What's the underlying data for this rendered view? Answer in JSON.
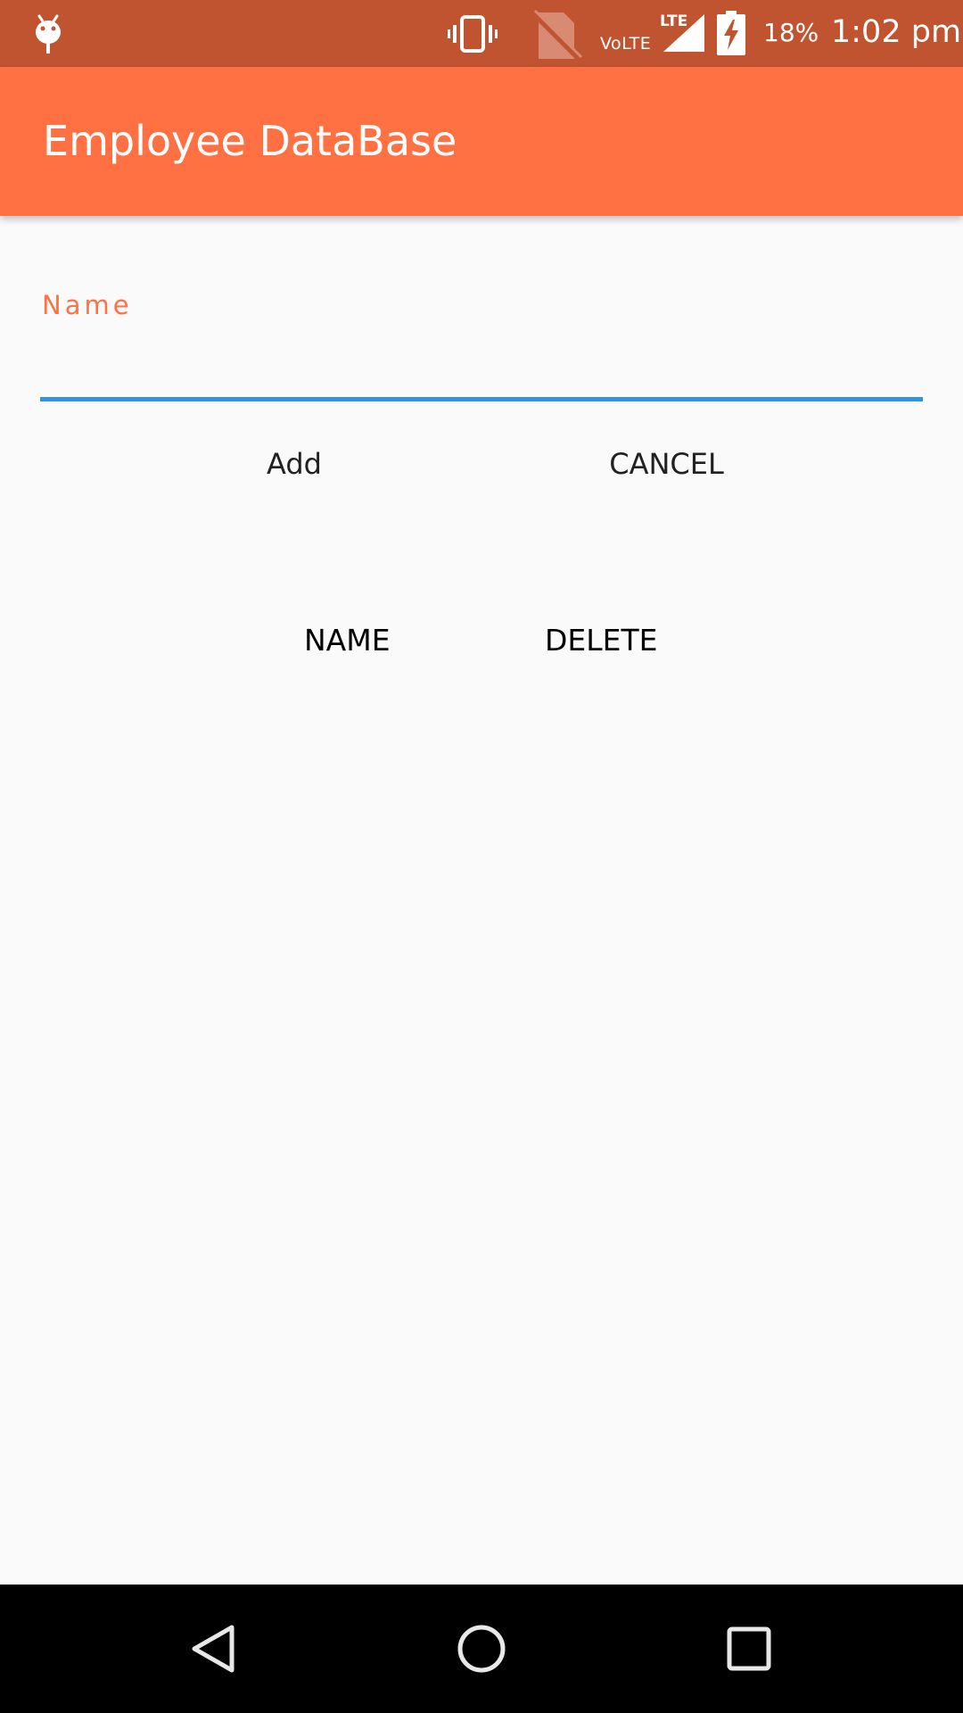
{
  "status_bar": {
    "network_label": "VoLTE",
    "lte_label": "LTE",
    "battery": "18%",
    "time": "1:02 pm",
    "icons": [
      "debug-icon",
      "vibrate-icon",
      "no-sim-icon",
      "signal-icon",
      "battery-charging-icon"
    ]
  },
  "app_bar": {
    "title": "Employee DataBase"
  },
  "form": {
    "name_label": "Name",
    "name_value": "",
    "add_label": "Add",
    "cancel_label": "CANCEL"
  },
  "table": {
    "columns": [
      "NAME",
      "DELETE"
    ],
    "rows": []
  },
  "nav_bar": {
    "icons": [
      "back-icon",
      "home-icon",
      "recents-icon"
    ]
  },
  "colors": {
    "status_bar": "#c05431",
    "app_bar": "#ff7043",
    "accent_label": "#ff7043",
    "input_underline": "#2f95e0",
    "background": "#fafafa"
  }
}
